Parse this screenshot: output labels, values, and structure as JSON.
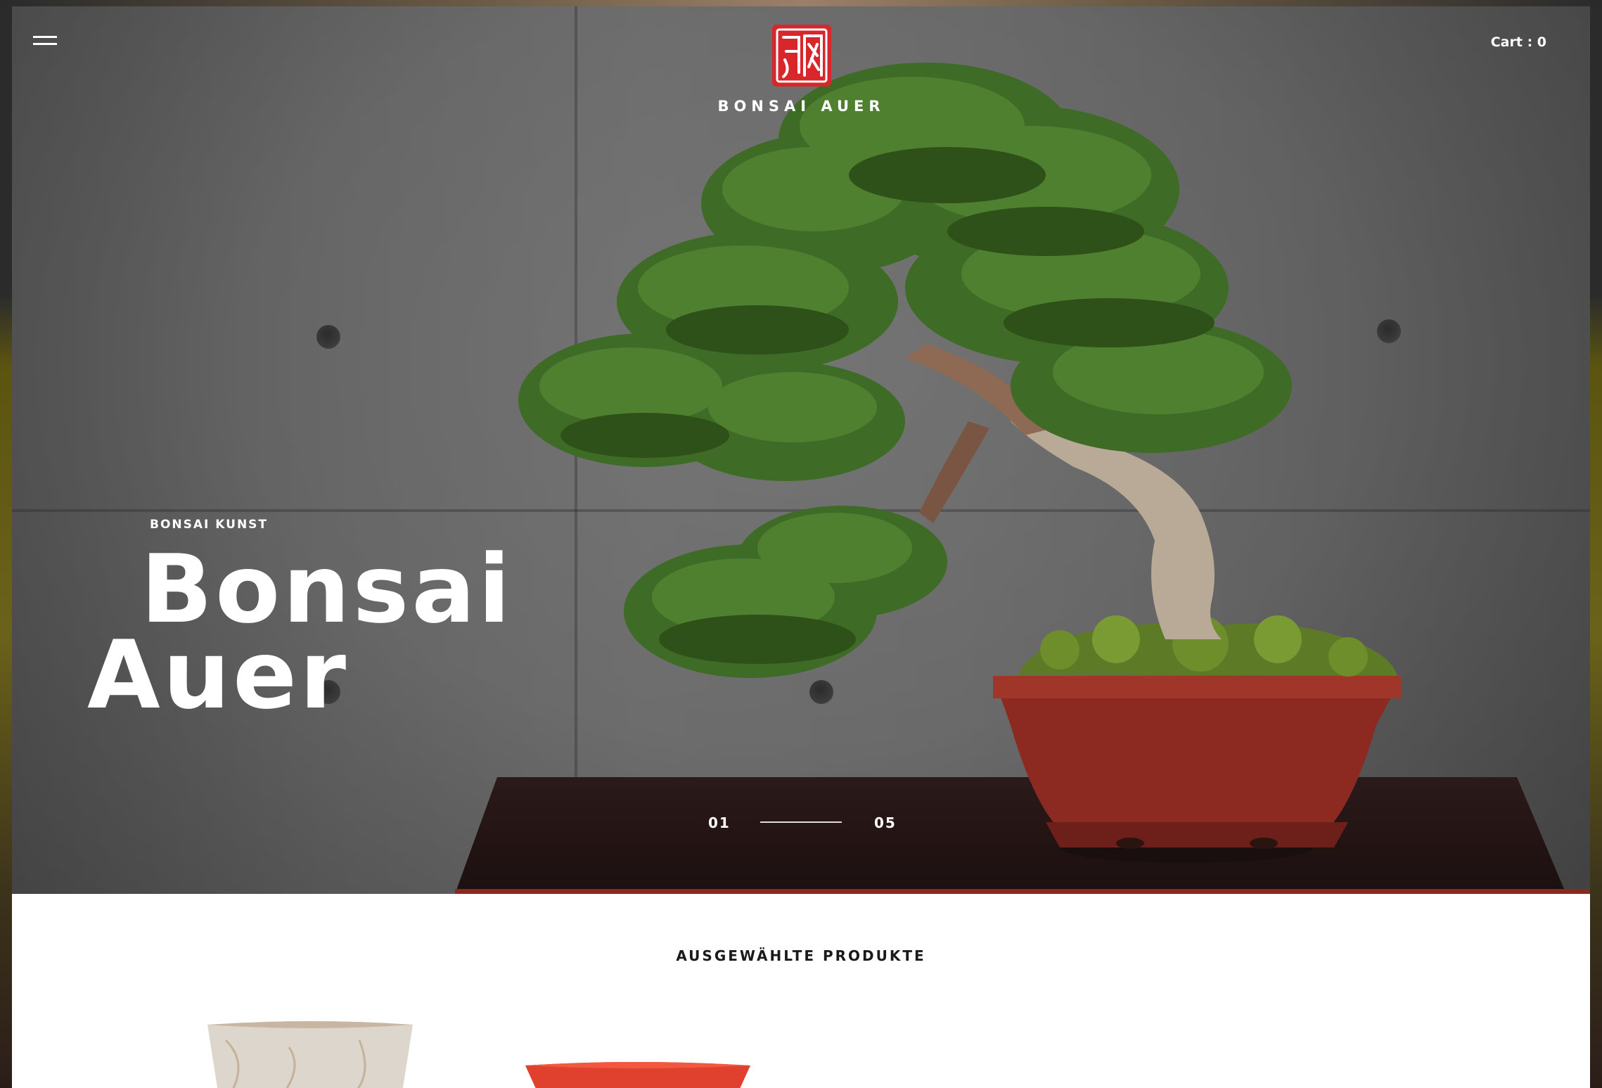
{
  "header": {
    "menu_icon": "hamburger-menu-icon",
    "logo_text": "BONSAI AUER",
    "cart_label": "Cart : 0"
  },
  "hero": {
    "eyebrow": "BONSAI KUNST",
    "title_line1": "Bonsai",
    "title_line2": "Auer",
    "slider": {
      "current": "01",
      "total": "05"
    }
  },
  "products_section": {
    "title": "AUSGEWÄHLTE PRODUKTE"
  },
  "colors": {
    "brand_red": "#d8262a",
    "text_light": "#ffffff",
    "text_dark": "#1a1a1a"
  }
}
